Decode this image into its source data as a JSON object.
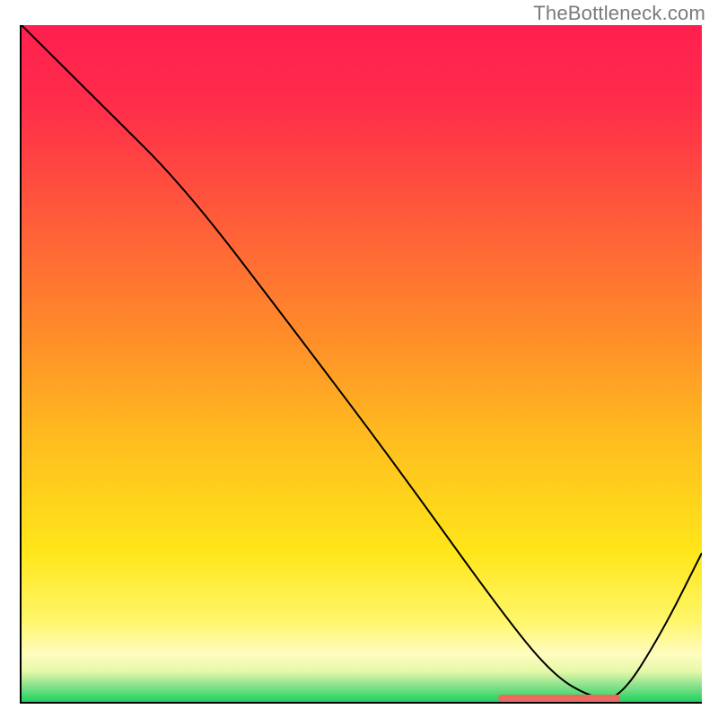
{
  "watermark": "TheBottleneck.com",
  "gradient_stops": [
    {
      "offset": 0,
      "color": "#ff1f4f"
    },
    {
      "offset": 0.12,
      "color": "#ff2d4a"
    },
    {
      "offset": 0.28,
      "color": "#ff5a3a"
    },
    {
      "offset": 0.45,
      "color": "#ff8a2a"
    },
    {
      "offset": 0.62,
      "color": "#ffbf1e"
    },
    {
      "offset": 0.78,
      "color": "#ffe61a"
    },
    {
      "offset": 0.88,
      "color": "#fff66a"
    },
    {
      "offset": 0.93,
      "color": "#fffcc0"
    },
    {
      "offset": 0.955,
      "color": "#e6f8a8"
    },
    {
      "offset": 0.975,
      "color": "#8ee38e"
    },
    {
      "offset": 1.0,
      "color": "#1fd15f"
    }
  ],
  "chart_data": {
    "type": "line",
    "x": [
      0.0,
      0.12,
      0.24,
      0.4,
      0.55,
      0.7,
      0.78,
      0.84,
      0.88,
      0.94,
      1.0
    ],
    "y": [
      1.0,
      0.88,
      0.76,
      0.55,
      0.35,
      0.14,
      0.04,
      0.005,
      0.005,
      0.1,
      0.22
    ],
    "title": "",
    "xlabel": "",
    "ylabel": "",
    "xlim": [
      0,
      1
    ],
    "ylim": [
      0,
      1
    ],
    "marker": {
      "x_start": 0.7,
      "x_end": 0.88,
      "color": "#ea6a5f"
    }
  }
}
